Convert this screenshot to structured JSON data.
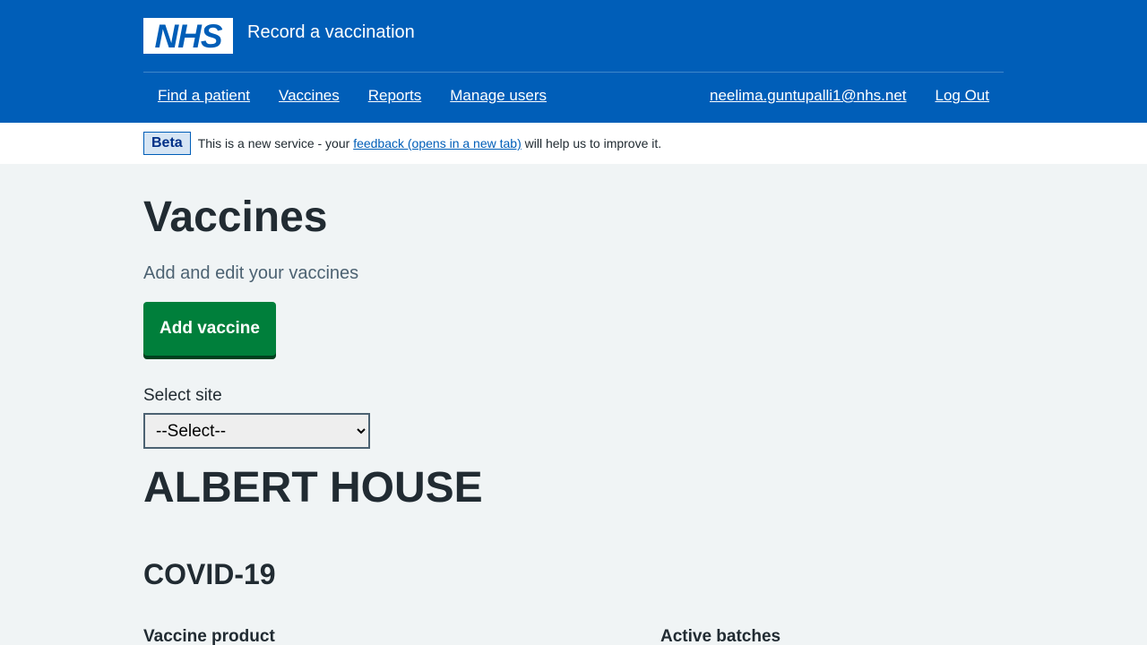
{
  "header": {
    "logo_text": "NHS",
    "service_name": "Record a vaccination",
    "nav_left": [
      "Find a patient",
      "Vaccines",
      "Reports",
      "Manage users"
    ],
    "nav_right": [
      "neelima.guntupalli1@nhs.net",
      "Log Out"
    ]
  },
  "beta": {
    "tag": "Beta",
    "text_before": "This is a new service - your ",
    "link": "feedback (opens in a new tab)",
    "text_after": " will help us to improve it."
  },
  "main": {
    "title": "Vaccines",
    "lede": "Add and edit your vaccines",
    "add_button": "Add vaccine",
    "select_label": "Select site",
    "select_value": "--Select--",
    "site_name": "ALBERT HOUSE",
    "vaccine_type": "COVID-19",
    "columns": [
      "Vaccine product",
      "Active batches"
    ]
  },
  "colors": {
    "nhs_blue": "#005eb8",
    "button_green": "#007f3b",
    "background": "#f0f4f5"
  }
}
